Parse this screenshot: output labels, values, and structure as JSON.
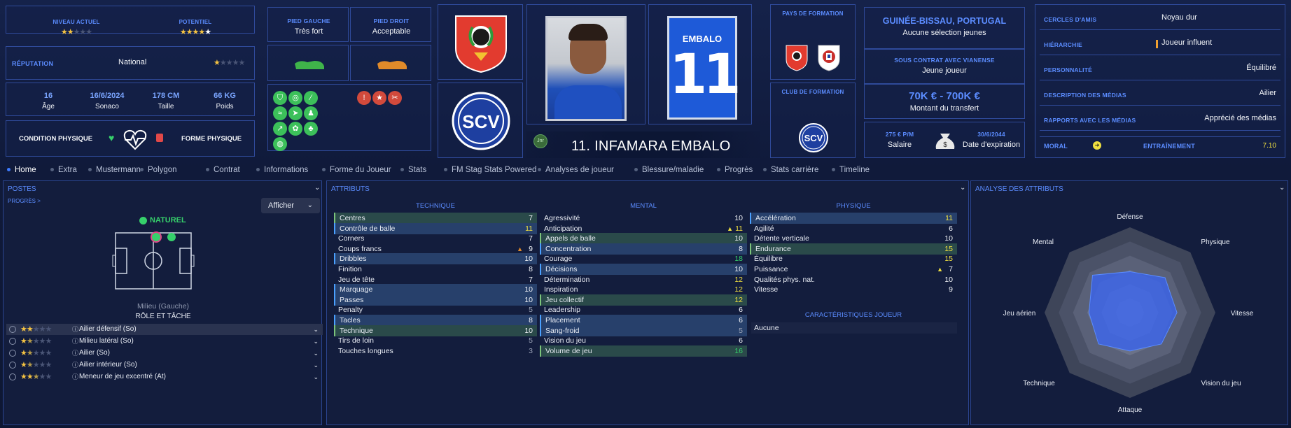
{
  "header": {
    "niveau_label": "NIVEAU ACTUEL",
    "niveau_stars": "★★☆☆☆",
    "potentiel_label": "POTENTIEL",
    "potentiel_stars": "★★★★★",
    "reputation_label": "RÉPUTATION",
    "reputation_value": "National",
    "reputation_stars": "★☆☆☆☆",
    "age_value": "16",
    "age_label": "Âge",
    "dob_value": "16/6/2024",
    "dob_label": "Sonaco",
    "height_value": "178 CM",
    "height_label": "Taille",
    "weight_value": "66 KG",
    "weight_label": "Poids",
    "condition_label": "CONDITION PHYSIQUE",
    "form_label": "FORME PHYSIQUE",
    "left_foot_label": "PIED GAUCHE",
    "left_foot_value": "Très fort",
    "right_foot_label": "PIED DROIT",
    "right_foot_value": "Acceptable",
    "shirt_name": "EMBALO",
    "shirt_number": "11",
    "player_title": "11. INFAMARA EMBALO",
    "junior_badge": "Jnr",
    "formation_country_label": "PAYS DE FORMATION",
    "formation_club_label": "CLUB DE FORMATION",
    "nationality": "GUINÉE-BISSAU, PORTUGAL",
    "national_selection": "Aucune sélection jeunes",
    "contract_label": "SOUS CONTRAT AVEC VIANENSE",
    "contract_value": "Jeune joueur",
    "transfer_value": "70K € - 700K €",
    "transfer_label": "Montant du transfert",
    "salary_value": "275 € P/M",
    "salary_label": "Salaire",
    "expiry_value": "30/6/2044",
    "expiry_label": "Date d'expiration",
    "club_badge_text": "SCV"
  },
  "profile": [
    {
      "label": "CERCLES D'AMIS",
      "value": "Noyau dur"
    },
    {
      "label": "HIÉRARCHIE",
      "value": "Joueur influent"
    },
    {
      "label": "PERSONNALITÉ",
      "value": "Équilibré"
    },
    {
      "label": "DESCRIPTION DES MÉDIAS",
      "value": "Ailier"
    },
    {
      "label": "RAPPORTS AVEC LES MÉDIAS",
      "value": "Apprécié des médias"
    }
  ],
  "moral_label": "MORAL",
  "training_label": "ENTRAÎNEMENT",
  "training_value": "7.10",
  "tabs": [
    "Home",
    "Extra",
    "Mustermann",
    "Polygon",
    "Contrat",
    "Informations",
    "Forme du Joueur",
    "Stats",
    "FM Stag Stats Powered",
    "Analyses de joueur",
    "Blessure/maladie",
    "Progrès",
    "Stats carrière",
    "Timeline"
  ],
  "positions": {
    "title": "POSTES",
    "progress_link": "PROGRÈS >",
    "show_button": "Afficher",
    "natural_label": "NATUREL",
    "position_name": "Milieu (Gauche)",
    "role_title": "RÔLE ET TÂCHE",
    "roles": [
      {
        "stars": "★★☆☆☆",
        "name": "Ailier défensif (So)"
      },
      {
        "stars": "★★☆☆☆",
        "name": "Milieu latéral (So)"
      },
      {
        "stars": "★★☆☆☆",
        "name": "Ailier (So)"
      },
      {
        "stars": "★★☆☆☆",
        "name": "Ailier intérieur (So)"
      },
      {
        "stars": "★★★☆☆",
        "name": "Meneur de jeu excentré (At)"
      }
    ]
  },
  "attributes": {
    "title": "ATTRIBUTS",
    "technique_label": "TECHNIQUE",
    "mental_label": "MENTAL",
    "physique_label": "PHYSIQUE",
    "technique": [
      {
        "n": "Centres",
        "v": "7",
        "h": 2
      },
      {
        "n": "Contrôle de balle",
        "v": "11",
        "h": 1
      },
      {
        "n": "Corners",
        "v": "7",
        "h": 0
      },
      {
        "n": "Coups francs",
        "v": "9",
        "h": 0,
        "t": "▲"
      },
      {
        "n": "Dribbles",
        "v": "10",
        "h": 1
      },
      {
        "n": "Finition",
        "v": "8",
        "h": 0
      },
      {
        "n": "Jeu de tête",
        "v": "7",
        "h": 0
      },
      {
        "n": "Marquage",
        "v": "10",
        "h": 1
      },
      {
        "n": "Passes",
        "v": "10",
        "h": 1
      },
      {
        "n": "Penalty",
        "v": "5",
        "h": 0
      },
      {
        "n": "Tacles",
        "v": "8",
        "h": 1
      },
      {
        "n": "Technique",
        "v": "10",
        "h": 2
      },
      {
        "n": "Tirs de loin",
        "v": "5",
        "h": 0
      },
      {
        "n": "Touches longues",
        "v": "3",
        "h": 0
      }
    ],
    "mental": [
      {
        "n": "Agressivité",
        "v": "10",
        "h": 0
      },
      {
        "n": "Anticipation",
        "v": "11",
        "h": 0,
        "t": "▲"
      },
      {
        "n": "Appels de balle",
        "v": "10",
        "h": 2
      },
      {
        "n": "Concentration",
        "v": "8",
        "h": 1
      },
      {
        "n": "Courage",
        "v": "18",
        "h": 0
      },
      {
        "n": "Décisions",
        "v": "10",
        "h": 1
      },
      {
        "n": "Détermination",
        "v": "12",
        "h": 0
      },
      {
        "n": "Inspiration",
        "v": "12",
        "h": 0
      },
      {
        "n": "Jeu collectif",
        "v": "12",
        "h": 2
      },
      {
        "n": "Leadership",
        "v": "6",
        "h": 0
      },
      {
        "n": "Placement",
        "v": "6",
        "h": 1
      },
      {
        "n": "Sang-froid",
        "v": "5",
        "h": 1
      },
      {
        "n": "Vision du jeu",
        "v": "6",
        "h": 0
      },
      {
        "n": "Volume de jeu",
        "v": "16",
        "h": 2
      }
    ],
    "physique": [
      {
        "n": "Accélération",
        "v": "11",
        "h": 1
      },
      {
        "n": "Agilité",
        "v": "6",
        "h": 0
      },
      {
        "n": "Détente verticale",
        "v": "10",
        "h": 0
      },
      {
        "n": "Endurance",
        "v": "15",
        "h": 2
      },
      {
        "n": "Équilibre",
        "v": "15",
        "h": 0
      },
      {
        "n": "Puissance",
        "v": "7",
        "h": 0,
        "t": "▲"
      },
      {
        "n": "Qualités phys. nat.",
        "v": "10",
        "h": 0
      },
      {
        "n": "Vitesse",
        "v": "9",
        "h": 0
      }
    ],
    "traits_label": "CARACTÉRISTIQUES JOUEUR",
    "traits_value": "Aucune"
  },
  "analysis": {
    "title": "ANALYSE DES ATTRIBUTS",
    "axes": [
      "Défense",
      "Physique",
      "Vitesse",
      "Vision du jeu",
      "Attaque",
      "Technique",
      "Jeu aérien",
      "Mental"
    ]
  },
  "colors": {
    "accent": "#5b8cff",
    "green": "#36d06b",
    "yellow": "#f0e040",
    "star": "#f5c342"
  }
}
